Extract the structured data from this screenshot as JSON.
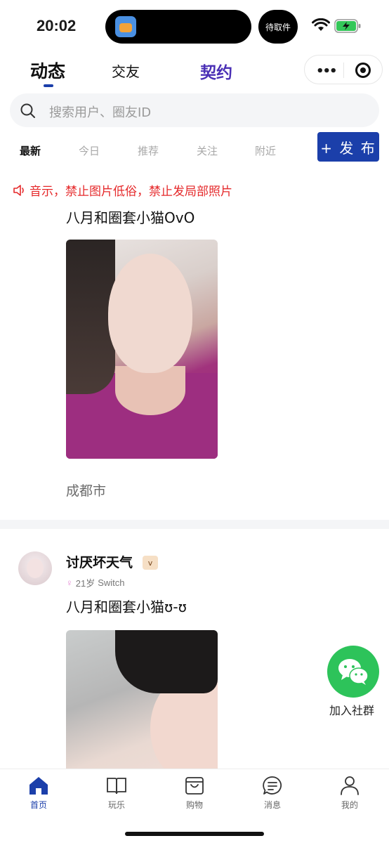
{
  "status": {
    "time": "20:02",
    "pickup": "待取件"
  },
  "header": {
    "tabs": [
      {
        "label": "动态",
        "active": true
      },
      {
        "label": "交友",
        "active": false
      },
      {
        "label": "契约",
        "active": false
      }
    ],
    "capsule_dots": "•••"
  },
  "search": {
    "placeholder": "搜索用户、圈友ID"
  },
  "filters": [
    {
      "label": "最新",
      "active": true
    },
    {
      "label": "今日",
      "active": false
    },
    {
      "label": "推荐",
      "active": false
    },
    {
      "label": "关注",
      "active": false
    },
    {
      "label": "附近",
      "active": false
    }
  ],
  "publish_label": "+ 发 布",
  "notice": "音示，禁止图片低俗，禁止发局部照片",
  "posts": [
    {
      "text": "八月和圈套小猫OvO",
      "location": "成都市"
    },
    {
      "username": "讨厌坏天气",
      "vip": "v",
      "gender_icon": "♀",
      "age": "21岁",
      "device": "Switch",
      "text": "八月和圈套小猫ʊ-ʊ"
    }
  ],
  "float_group": {
    "label": "加入社群"
  },
  "bottom_nav": [
    {
      "label": "首页",
      "icon": "home-icon",
      "active": true
    },
    {
      "label": "玩乐",
      "icon": "book-icon",
      "active": false
    },
    {
      "label": "购物",
      "icon": "bag-icon",
      "active": false
    },
    {
      "label": "消息",
      "icon": "message-icon",
      "active": false
    },
    {
      "label": "我的",
      "icon": "person-icon",
      "active": false
    }
  ],
  "colors": {
    "accent": "#1b3faa",
    "notice": "#e5282a",
    "wechat": "#2dc35a"
  }
}
